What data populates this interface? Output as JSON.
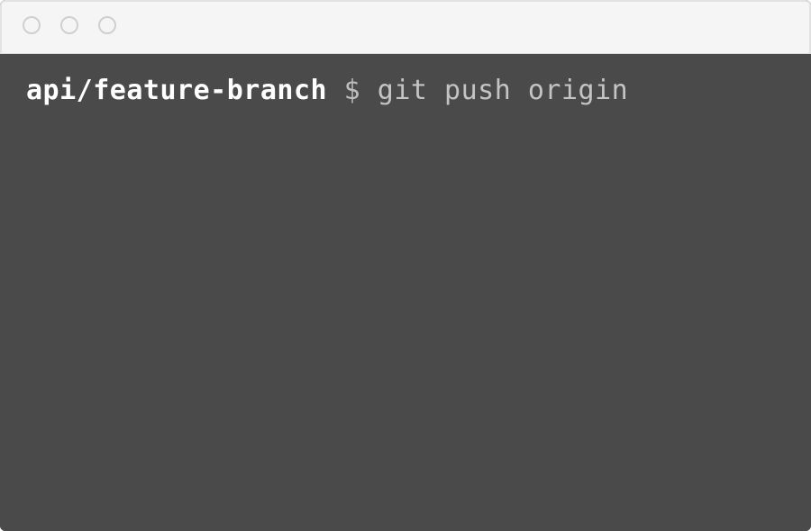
{
  "window": {
    "controls": [
      {
        "name": "close-button"
      },
      {
        "name": "minimize-button"
      },
      {
        "name": "zoom-button"
      }
    ]
  },
  "terminal": {
    "branch": "api/feature-branch",
    "prompt_symbol": "$",
    "command": "git push origin"
  },
  "colors": {
    "terminal_background": "#4a4a4a",
    "titlebar_background": "#f5f5f5",
    "branch_text": "#ffffff",
    "command_text": "#c4c4c4"
  }
}
